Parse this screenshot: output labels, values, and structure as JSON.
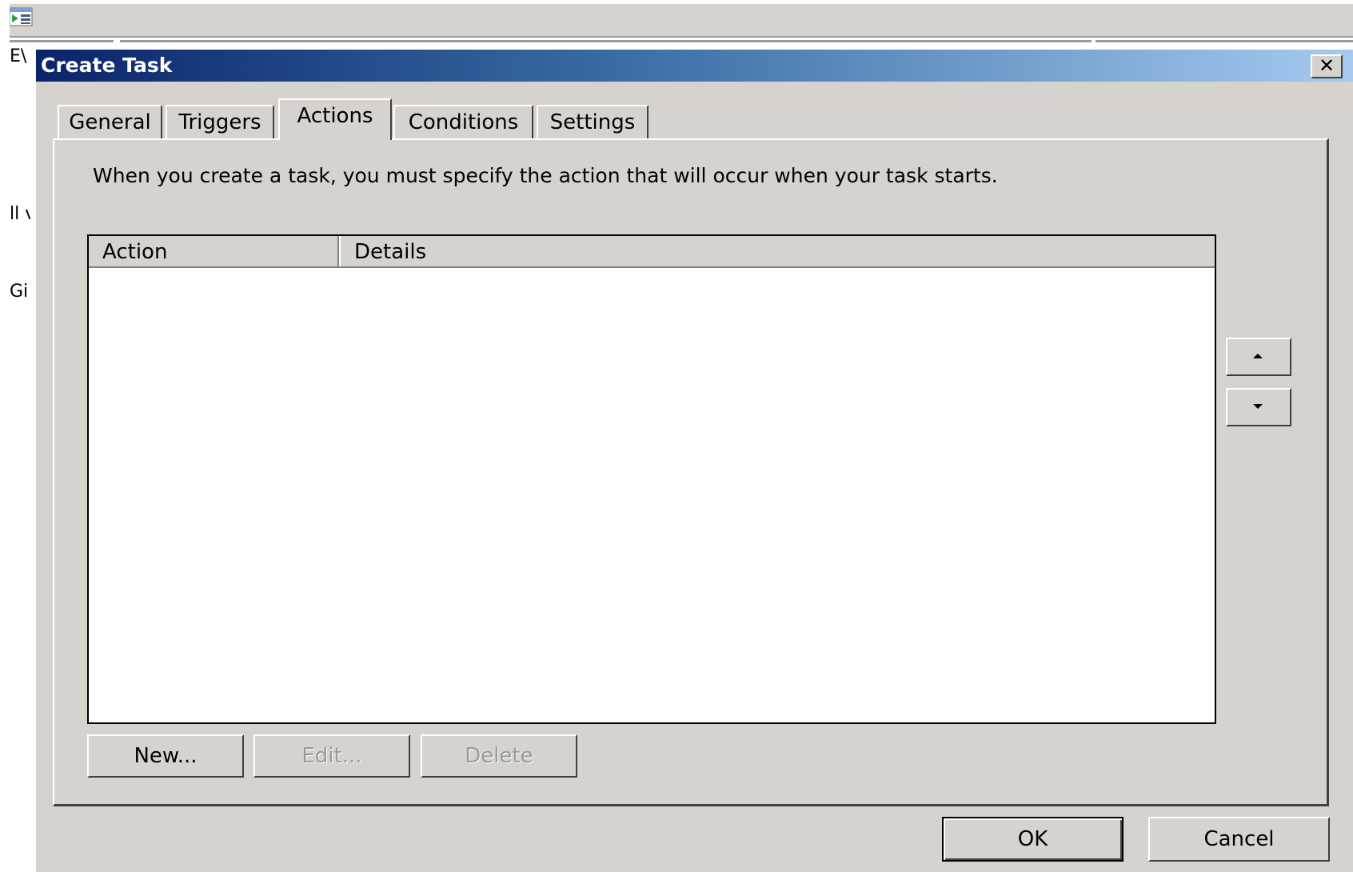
{
  "background": {
    "fragments": [
      "E\\",
      "ll v",
      "Gi"
    ]
  },
  "dialog": {
    "title": "Create Task",
    "close_glyph": "✕",
    "tabs": [
      {
        "label": "General"
      },
      {
        "label": "Triggers"
      },
      {
        "label": "Actions",
        "active": true
      },
      {
        "label": "Conditions"
      },
      {
        "label": "Settings"
      }
    ],
    "actions_tab": {
      "description": "When you create a task, you must specify the action that will occur when your task starts.",
      "columns": [
        "Action",
        "Details"
      ],
      "rows": [],
      "move_up_icon": "arrow-up-icon",
      "move_down_icon": "arrow-down-icon",
      "new_label": "New...",
      "edit_label": "Edit...",
      "delete_label": "Delete"
    },
    "ok_label": "OK",
    "cancel_label": "Cancel"
  },
  "colors": {
    "dialog_face": "#d6d3ce",
    "titlebar_start": "#0a246a",
    "titlebar_end": "#a6caf0",
    "disabled_text": "#9a9a9a"
  }
}
